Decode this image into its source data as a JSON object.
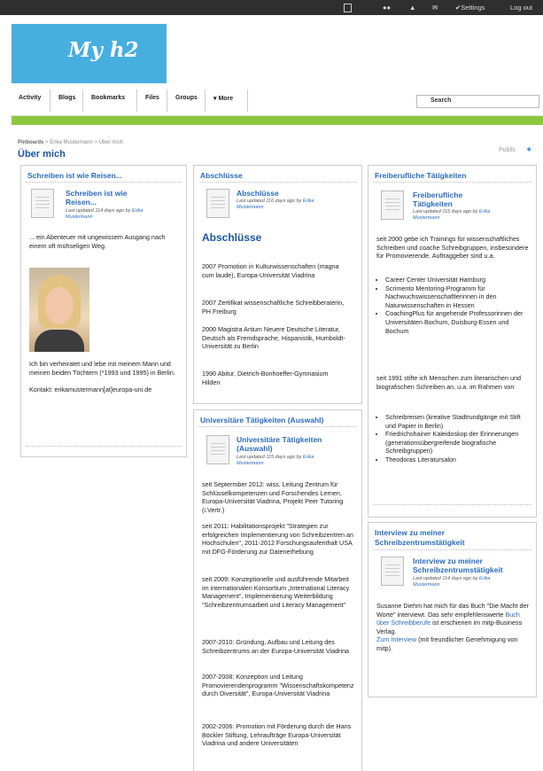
{
  "topbar": {
    "settings": "Settings",
    "logout": "Log out"
  },
  "logo": "My h2",
  "nav": {
    "tabs": [
      "Activity",
      "Blogs",
      "Bookmarks",
      "Files",
      "Groups",
      "▾ More"
    ],
    "search_placeholder": "Search"
  },
  "breadcrumb": {
    "a": "Pinboards",
    "b": "Erika Mustermann",
    "c": "Über mich"
  },
  "page_title": "Über mich",
  "public": "Public",
  "col1": {
    "head": "Schreiben ist wie Reisen...",
    "title1": "Schreiben ist wie",
    "title2": "Reisen...",
    "meta": "Last updated 114 days ago by",
    "author": "Erika",
    "author2": "Mustermann",
    "p1": "... ein Abenteuer mit ungewissem Ausgang nach einem oft mühseligen Weg.",
    "p2": "Ich bin verheiratet und lebe mit meinem Mann und meinen beiden Töchtern (*1993 und 1995) in Berlin.",
    "p3": "Kontakt: erikamustermann[at]europa-uni.de"
  },
  "col2a": {
    "head": "Abschlüsse",
    "title": "Abschlüsse",
    "meta": "Last updated 116 days ago by",
    "author": "Erika",
    "author2": "Mustermann",
    "h2": "Abschlüsse",
    "items": [
      "2007 Promotion in Kulturwissenschaften (magna cum laude), Europa-Universität Viadrina",
      "2007 Zertifikat wissenschaftliche Schreibberaterin, PH Freiburg",
      "2000 Magistra Artium Neuere Deutsche Literatur, Deutsch als Fremdsprache, Hispanistik, Humboldt-Universität zu Berlin",
      "1990 Abitur, Dietrich-Bonhoeffer-Gymnasium Hilden"
    ]
  },
  "col2b": {
    "head": "Universitäre Tätigkeiten (Auswahl)",
    "title1": "Universitäre Tätigkeiten",
    "title2": "(Auswahl)",
    "meta": "Last updated 115 days ago by",
    "author": "Erika",
    "author2": "Mustermann",
    "items": [
      "seit Septermber 2012: wiss. Leitung Zentrum für Schlüsselkompetenzen und Forschendes Lernen, Europa-Universität Viadrina, Projekt Peer Tutoring (i.Vertr.)",
      "seit 2011: Habilitationsprojekt \"Strategien zur erfolgreichen Implementierung von Schreibzentren an Hochschulen\", 2011-2012 Forschungsaufenthalt USA mit DFG-Förderung zur Datenerhebung",
      "seit 2009: Konzeptionelle und ausführende Mitarbeit im internationalen Konsortium „International Literacy Management“, Implementierung Weiterbildung \"Schreibzentrumsarbeit und Literacy Management\"",
      "2007-2010: Gründung, Aufbau und Leitung des Schreibzentrums an der Europa-Universität Viadrina",
      "2007-2008: Konzeption und Leitung Promovierendenprogramm \"Wissenschaftskompetenz durch Diversität\", Europa-Universität Viadrina",
      "2002-2006: Promotion mit Förderung durch die Hans Böckler Stiftung, Lehraufträge Europa-Universität Viadrina und andere Universitäten"
    ]
  },
  "col3a": {
    "head": "Freiberufliche Tätigkeiten",
    "title1": "Freiberufliche",
    "title2": "Tätigkeiten",
    "meta": "Last updated 115 days ago by",
    "author": "Erika",
    "author2": "Mustermann",
    "p1": "seit 2000 gebe ich Trainings für wissenschaftliches Schreiben und coache Schreibgruppen, insbesondere für Promovierende. Auftraggeber sind u.a.",
    "list1": [
      "Career Center Universität Hamburg",
      "Scrimento Mentoring-Programm für Nachwuchswissenschaftlerinnen in den Naturwissenschaften in Hessen",
      "CoachingPlus für angehende Professorinnen der Universitäten Bochum, Duisburg-Essen und Bochum"
    ],
    "p2": "seit 1991 stifte ich Menschen zum literarischen und biografischen Schreiben an, u.a. im Rahmen von",
    "list2": [
      "Schreibreisen (kreative Stadtrundgänge mit Stift und Papier in Berlin)",
      "Friedrichshainer Kaleidoskop der Erinnerungen (generationsübergreifende biografische Schreibgruppen)",
      "Theodoras Literatursalon"
    ]
  },
  "col3b": {
    "head1": "Interview zu meiner",
    "head2": "Schreibzentrumstätigkeit",
    "title1": "Interview zu meiner",
    "title2": "Schreibzentrumstätigkeit",
    "meta": "Last updated 114 days ago by",
    "author": "Erika",
    "author2": "Mustermann",
    "p1": "Susanne Diehm hat mich für das Buch \"Die Macht der Worte\" interviewt. Das sehr empfehlenswerte",
    "link1": "Buch über Schreibberufe",
    "p1b": "ist erschienen im mitp-Business Verlag.",
    "link2": "Zum Interview",
    "p2": "(mit freundlicher Genehmigung von mitp)."
  }
}
